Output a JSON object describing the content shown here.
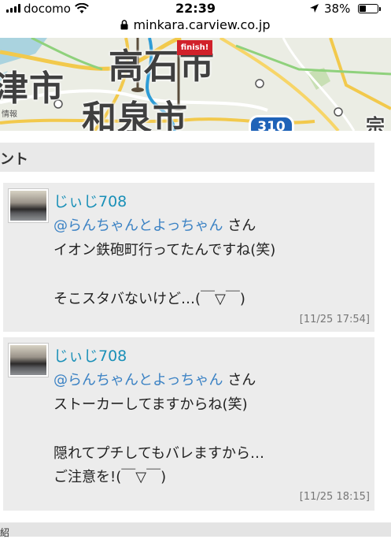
{
  "status_bar": {
    "carrier": "docomo",
    "time": "22:39",
    "battery": "38%",
    "battery_level": 0.38
  },
  "url_bar": {
    "url": "minkara.carview.co.jp"
  },
  "map": {
    "city_top": "高石市",
    "city_left": "津市",
    "city_center": "和泉市",
    "city_right": "宗",
    "small_label": "情報",
    "route_number": "310",
    "finish_label": "finish!"
  },
  "section": {
    "title": "ント"
  },
  "comments": [
    {
      "user": "じぃじ708",
      "mention": "@らんちゃんとよっちゃん",
      "honorific": "さん",
      "lines": [
        "イオン鉄砲町行ってたんですね(笑)",
        "",
        "そこスタバないけど…(￣▽￣)"
      ],
      "timestamp": "[11/25 17:54]"
    },
    {
      "user": "じぃじ708",
      "mention": "@らんちゃんとよっちゃん",
      "honorific": "さん",
      "lines": [
        "ストーカーしてますからね(笑)",
        "",
        "隠れてプチしてもバレますから…",
        "ご注意を!(￣▽￣)"
      ],
      "timestamp": "[11/25 18:15]"
    }
  ],
  "bottom": {
    "label": "紹"
  },
  "colors": {
    "username": "#1a90b8",
    "mention": "#3b82c4",
    "comment_bg": "#ececec"
  }
}
